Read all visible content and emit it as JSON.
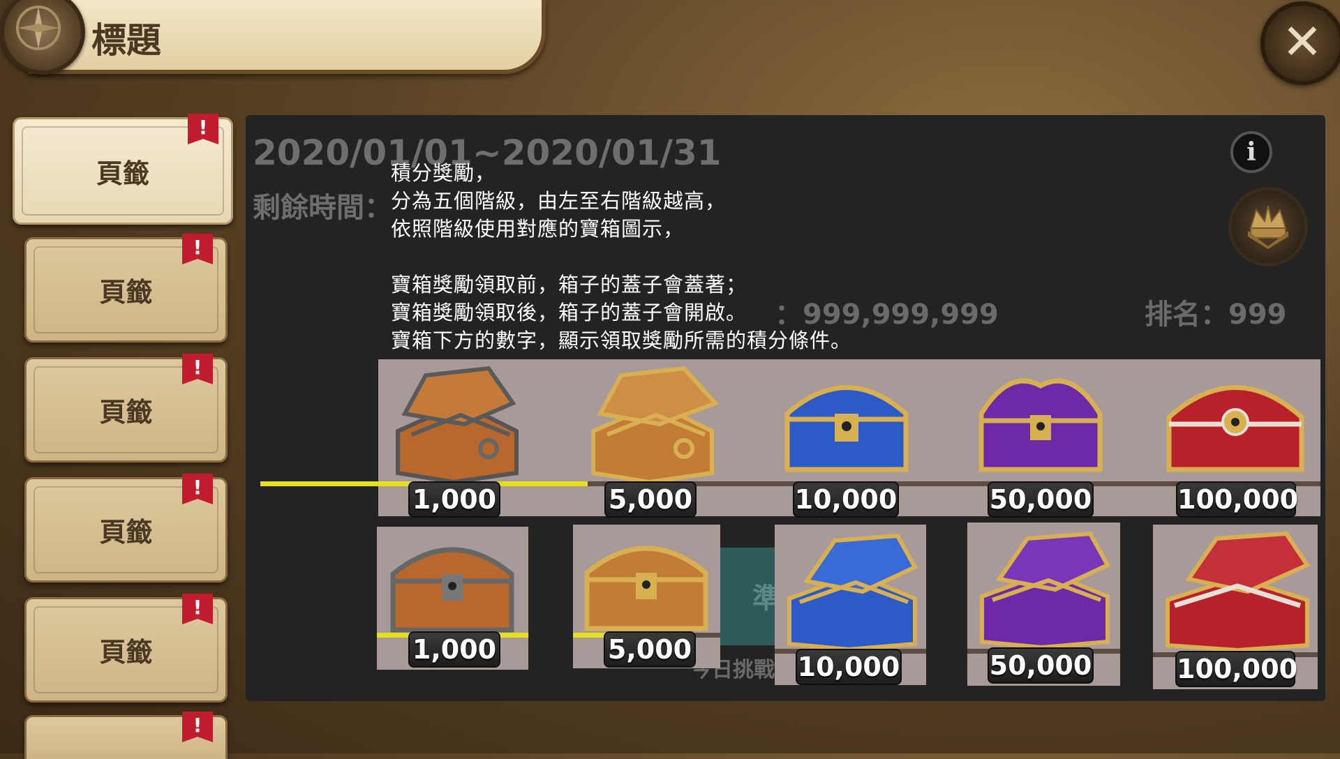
{
  "header": {
    "title": "標題",
    "compass_icon": "compass-icon",
    "close_icon": "close-icon"
  },
  "tabs": [
    {
      "label": "頁籤",
      "alert": "!"
    },
    {
      "label": "頁籤",
      "alert": "!"
    },
    {
      "label": "頁籤",
      "alert": "!"
    },
    {
      "label": "頁籤",
      "alert": "!"
    },
    {
      "label": "頁籤",
      "alert": "!"
    },
    {
      "label": "",
      "alert": "!"
    }
  ],
  "panel": {
    "date_range": "2020/01/01~2020/01/31",
    "remaining_label": "剩餘時間：",
    "score_value": "：999,999,999",
    "rank": "排名：999",
    "ready_label": "準",
    "daily_label": "今日挑戰"
  },
  "note": {
    "lines": [
      "積分獎勵，",
      "分為五個階級，由左至右階級越高，",
      "依照階級使用對應的寶箱圖示，",
      "",
      "寶箱獎勵領取前，箱子的蓋子會蓋著；",
      "寶箱獎勵領取後，箱子的蓋子會開啟。",
      "寶箱下方的數字，顯示領取獎勵所需的積分條件。"
    ]
  },
  "chests_open": [
    {
      "value": "1,000",
      "tier": "iron"
    },
    {
      "value": "5,000",
      "tier": "wood-gold"
    },
    {
      "value": "10,000",
      "tier": "blue"
    },
    {
      "value": "50,000",
      "tier": "purple"
    },
    {
      "value": "100,000",
      "tier": "red"
    }
  ],
  "chests_closed": [
    {
      "value": "1,000",
      "tier": "iron",
      "lid": "closed"
    },
    {
      "value": "5,000",
      "tier": "wood-gold",
      "lid": "closed"
    },
    {
      "value": "10,000",
      "tier": "blue",
      "lid": "open"
    },
    {
      "value": "50,000",
      "tier": "purple",
      "lid": "open"
    },
    {
      "value": "100,000",
      "tier": "red",
      "lid": "open"
    }
  ],
  "colors": {
    "panel_bg": "#232323",
    "progress_yellow": "#e5e01b",
    "alert_red": "#c21d2e",
    "chest_strip": "#a89a98"
  },
  "icons": {
    "info": "i",
    "crown": "crown-icon"
  }
}
